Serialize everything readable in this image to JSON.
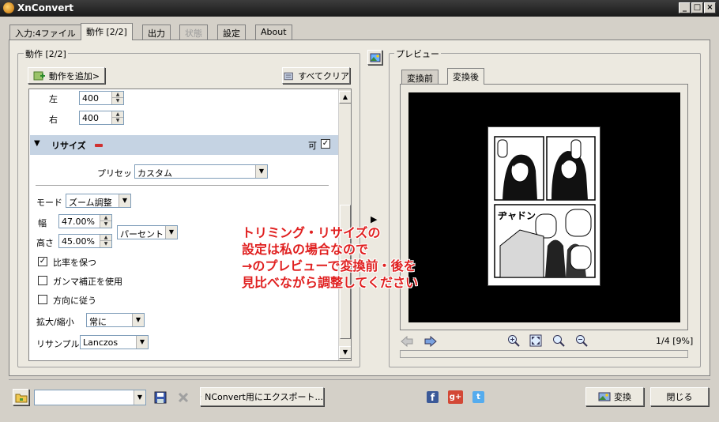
{
  "window": {
    "title": "XnConvert"
  },
  "tabs": [
    {
      "label": "入力:4ファイル"
    },
    {
      "label": "動作 [2/2]"
    },
    {
      "label": "出力"
    },
    {
      "label": "状態"
    },
    {
      "label": "設定"
    },
    {
      "label": "About"
    }
  ],
  "actions": {
    "group_label": "動作 [2/2]",
    "add_button": "動作を追加>",
    "clear_button": "すべてクリア",
    "crop": {
      "left_label": "左",
      "left_value": "400",
      "right_label": "右",
      "right_value": "400"
    },
    "resize": {
      "title": "リサイズ",
      "enabled_label": "可",
      "enabled": true,
      "preset_label": "プリセット",
      "preset_value": "カスタム",
      "mode_label": "モード",
      "mode_value": "ズーム調整",
      "width_label": "幅",
      "width_value": "47.00%",
      "height_label": "高さ",
      "height_value": "45.00%",
      "unit_value": "パーセント",
      "keep_ratio_label": "比率を保つ",
      "keep_ratio": true,
      "gamma_label": "ガンマ補正を使用",
      "gamma": false,
      "orientation_label": "方向に従う",
      "orientation": false,
      "scale_label": "拡大/縮小",
      "scale_value": "常に",
      "resample_label": "リサンプル",
      "resample_value": "Lanczos"
    }
  },
  "preview": {
    "group_label": "プレビュー",
    "tab_before": "変換前",
    "tab_after": "変換後",
    "page_counter": "1/4 [9%]",
    "manga_sfx": "ヂャドン"
  },
  "annotation": {
    "line1": "トリミング・リサイズの",
    "line2": "設定は私の場合なので",
    "line3": "→のプレビューで変換前・後を",
    "line4": "見比べながら調整してください"
  },
  "bottom": {
    "path_value": "",
    "export_button": "NConvert用にエクスポート...",
    "convert_button": "変換",
    "close_button": "閉じる"
  },
  "colors": {
    "annotation": "#e02020",
    "section_bar": "#c5d3e3",
    "titlebar": "#2a2a2a"
  }
}
